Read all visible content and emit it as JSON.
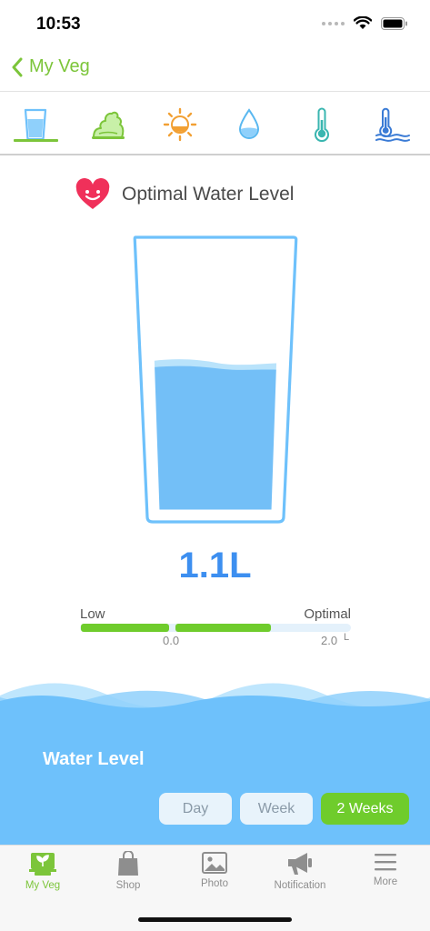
{
  "status": {
    "time": "10:53"
  },
  "nav": {
    "back_label": "My Veg"
  },
  "tabs": [
    {
      "icon": "water-glass-icon",
      "active": true
    },
    {
      "icon": "soil-fertilizer-icon",
      "active": false
    },
    {
      "icon": "sunlight-icon",
      "active": false
    },
    {
      "icon": "water-drop-icon",
      "active": false
    },
    {
      "icon": "thermometer-icon",
      "active": false
    },
    {
      "icon": "water-temperature-icon",
      "active": false
    }
  ],
  "main": {
    "heading": "Optimal Water Level",
    "heading_icon": "heart-smile-icon",
    "water_level_value": "1.1L",
    "water_fill_fraction": 0.55,
    "scale": {
      "low_label": "Low",
      "optimal_label": "Optimal",
      "min": "0.0",
      "max": "2.0",
      "unit": "L"
    }
  },
  "card": {
    "title": "Water Level",
    "range_options": [
      "Day",
      "Week",
      "2 Weeks"
    ],
    "selected_range": "2 Weeks"
  },
  "tab_bar": {
    "items": [
      {
        "label": "My Veg",
        "icon": "plant-pot-icon",
        "active": true
      },
      {
        "label": "Shop",
        "icon": "shopping-bag-icon",
        "active": false
      },
      {
        "label": "Photo",
        "icon": "photo-icon",
        "active": false
      },
      {
        "label": "Notification",
        "icon": "megaphone-icon",
        "active": false
      },
      {
        "label": "More",
        "icon": "menu-icon",
        "active": false
      }
    ]
  },
  "colors": {
    "accent_green": "#7cc53a",
    "water_blue": "#6ec1fb",
    "value_blue": "#3d8ff0",
    "heart_red": "#f0305a"
  }
}
